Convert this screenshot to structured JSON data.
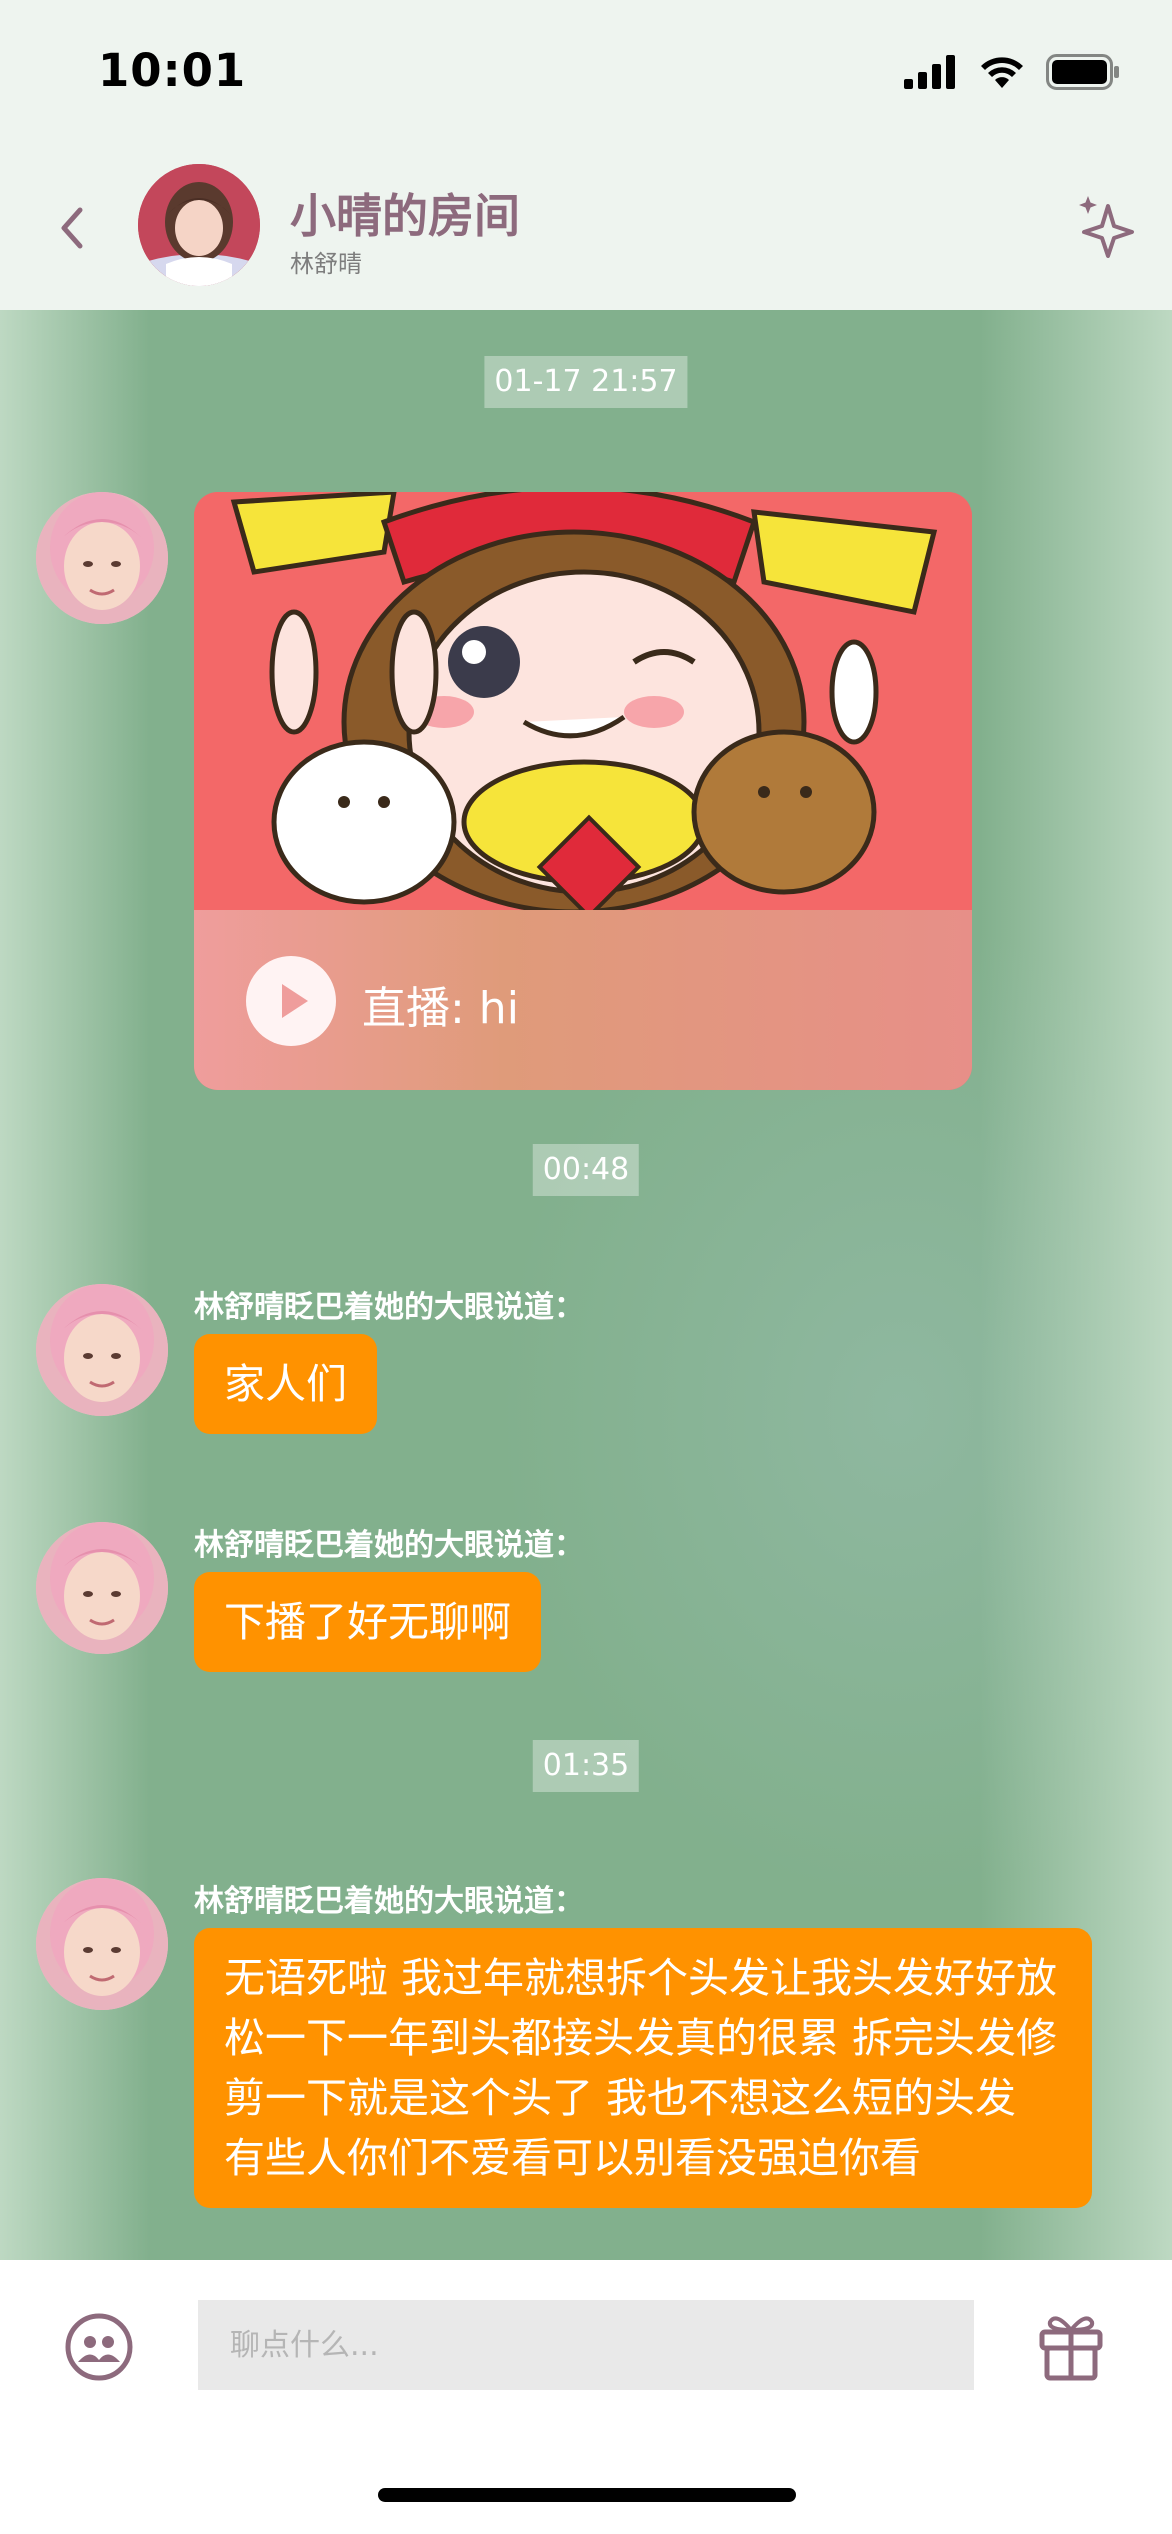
{
  "status_bar": {
    "time": "10:01"
  },
  "header": {
    "title": "小晴的房间",
    "subtitle": "林舒晴"
  },
  "messages": {
    "ts1": "01-17 21:57",
    "live": {
      "label": "直播: hi"
    },
    "ts2": "00:48",
    "m1": {
      "sender": "林舒晴眨巴着她的大眼说道：",
      "text": "家人们"
    },
    "m2": {
      "sender": "林舒晴眨巴着她的大眼说道：",
      "text": "下播了好无聊啊"
    },
    "ts3": "01:35",
    "m3": {
      "sender": "林舒晴眨巴着她的大眼说道：",
      "text": "无语死啦 我过年就想拆个头发让我头发好好放松一下一年到头都接头发真的很累 拆完头发修剪一下就是这个头了 我也不想这么短的头发 有些人你们不爱看可以别看没强迫你看"
    }
  },
  "input": {
    "placeholder": "聊点什么..."
  },
  "icons": {
    "back": "chevron-left-icon",
    "sparkle": "sparkle-icon",
    "emoji": "group-face-icon",
    "gift": "gift-icon"
  },
  "colors": {
    "accent": "#8d6a7d",
    "bubble": "#ff9200",
    "chat_bg": "#82b08d"
  }
}
